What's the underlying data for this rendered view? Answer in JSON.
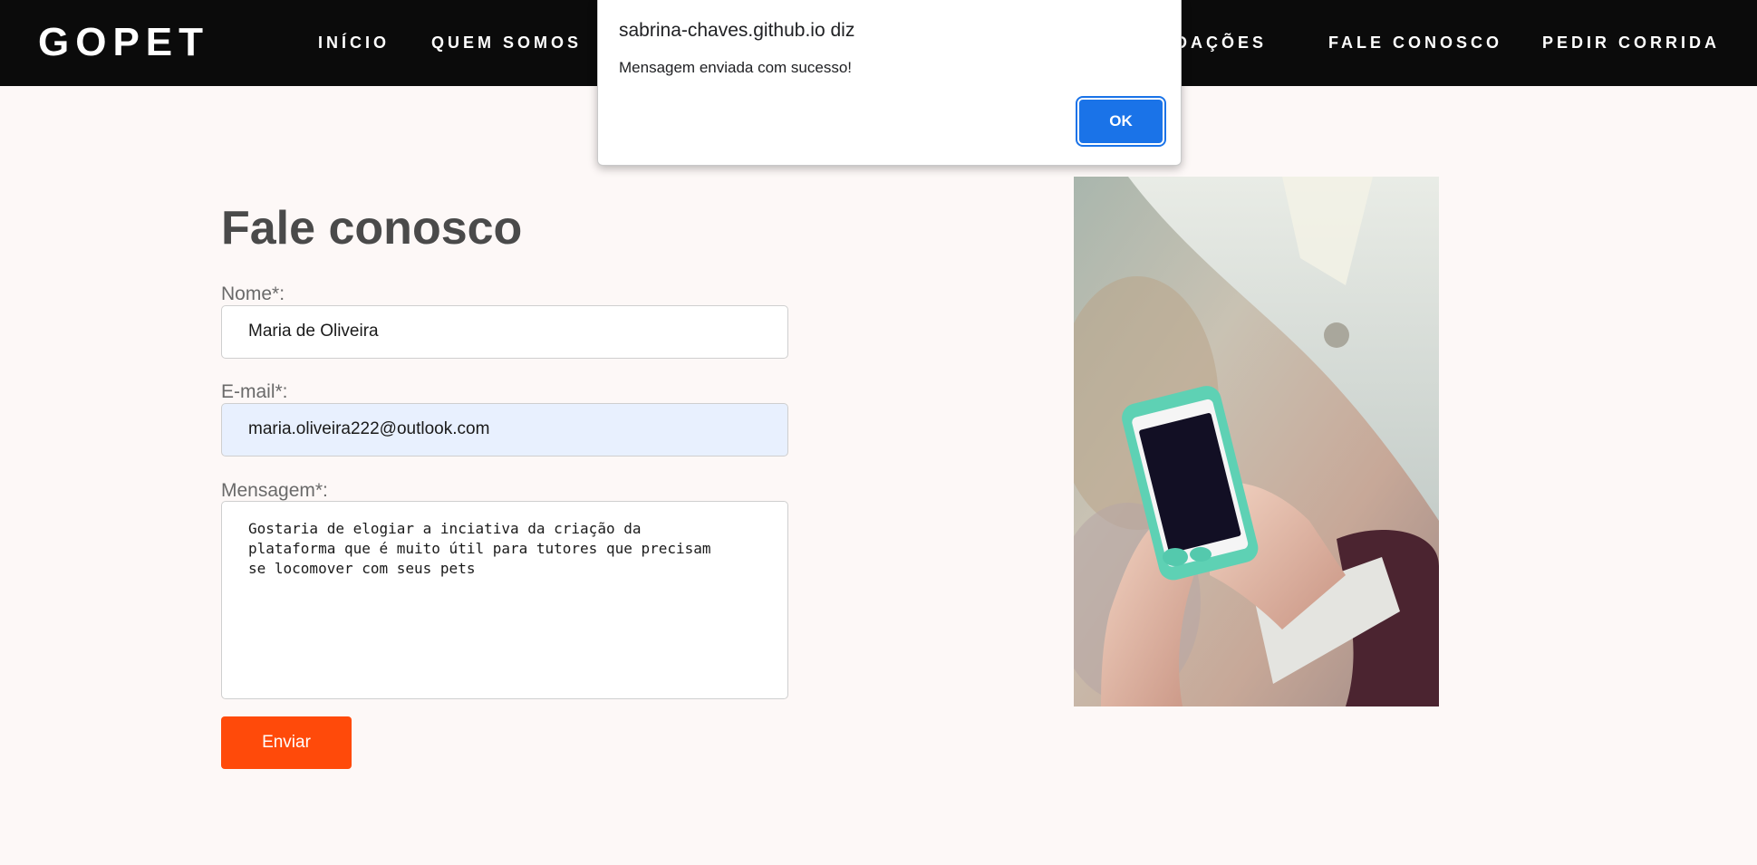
{
  "navbar": {
    "brand": "GOPET",
    "links": [
      "INÍCIO",
      "QUEM SOMOS",
      "NDAÇÕES",
      "FALE CONOSCO",
      "PEDIR CORRIDA"
    ]
  },
  "form": {
    "title": "Fale conosco",
    "name_label": "Nome*:",
    "name_value": "Maria de Oliveira",
    "email_label": "E-mail*:",
    "email_value": "maria.oliveira222@outlook.com",
    "message_label": "Mensagem*:",
    "message_value": "Gostaria de elogiar a inciativa da criação da\nplataforma que é muito útil para tutores que precisam\nse locomover com seus pets",
    "submit_label": "Enviar"
  },
  "alert": {
    "origin": "sabrina-chaves.github.io diz",
    "message": "Mensagem enviada com sucesso!",
    "ok_label": "OK"
  },
  "colors": {
    "navbar_bg": "#0b0b0b",
    "page_bg": "#fdf8f7",
    "submit_bg": "#ff4a0a",
    "alert_button_bg": "#1a73e8",
    "autofill_bg": "#e8f0fe"
  },
  "image": {
    "subject": "person-holding-smartphone-photo"
  }
}
